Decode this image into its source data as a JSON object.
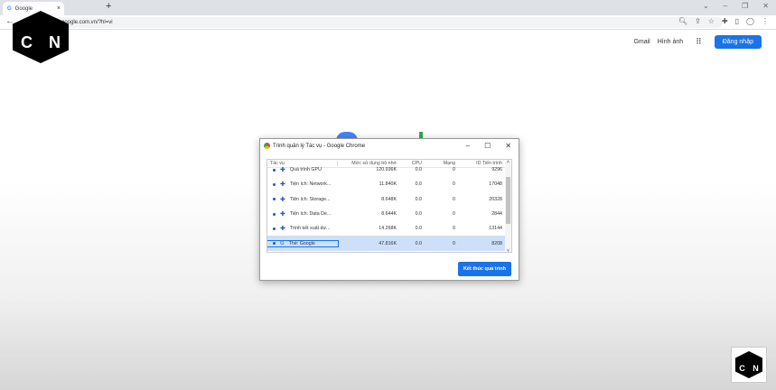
{
  "browser": {
    "tab_title": "Google",
    "url": "google.com.vn/?hl=vi"
  },
  "page": {
    "gmail": "Gmail",
    "images": "Hình ảnh",
    "signin": "Đăng nhập"
  },
  "dialog": {
    "title": "Trình quản lý Tác vụ - Google Chrome",
    "columns": [
      "Tác vụ",
      "Mức sử dụng bộ nhớ",
      "CPU",
      "Mạng",
      "ID Tiến trình"
    ],
    "rows": [
      {
        "name": "Quá trình GPU",
        "mem": "120.936K",
        "cpu": "0.0",
        "net": "0",
        "pid": "9296",
        "icon": "puzzle"
      },
      {
        "name": "Tiện ích: Network...",
        "mem": "11.840K",
        "cpu": "0.0",
        "net": "0",
        "pid": "17048",
        "icon": "puzzle"
      },
      {
        "name": "Tiện ích: Storage...",
        "mem": "8.648K",
        "cpu": "0.0",
        "net": "0",
        "pid": "20328",
        "icon": "puzzle"
      },
      {
        "name": "Tiện ích: Data De...",
        "mem": "8.644K",
        "cpu": "0.0",
        "net": "0",
        "pid": "2844",
        "icon": "puzzle"
      },
      {
        "name": "Trình kết xuất dư...",
        "mem": "14.268K",
        "cpu": "0.0",
        "net": "0",
        "pid": "13144",
        "icon": "puzzle"
      },
      {
        "name": "Thẻ: Google",
        "mem": "47.816K",
        "cpu": "0.0",
        "net": "0",
        "pid": "8208",
        "icon": "google"
      }
    ],
    "end_button": "Kết thúc quá trình"
  },
  "watermark": "CN"
}
